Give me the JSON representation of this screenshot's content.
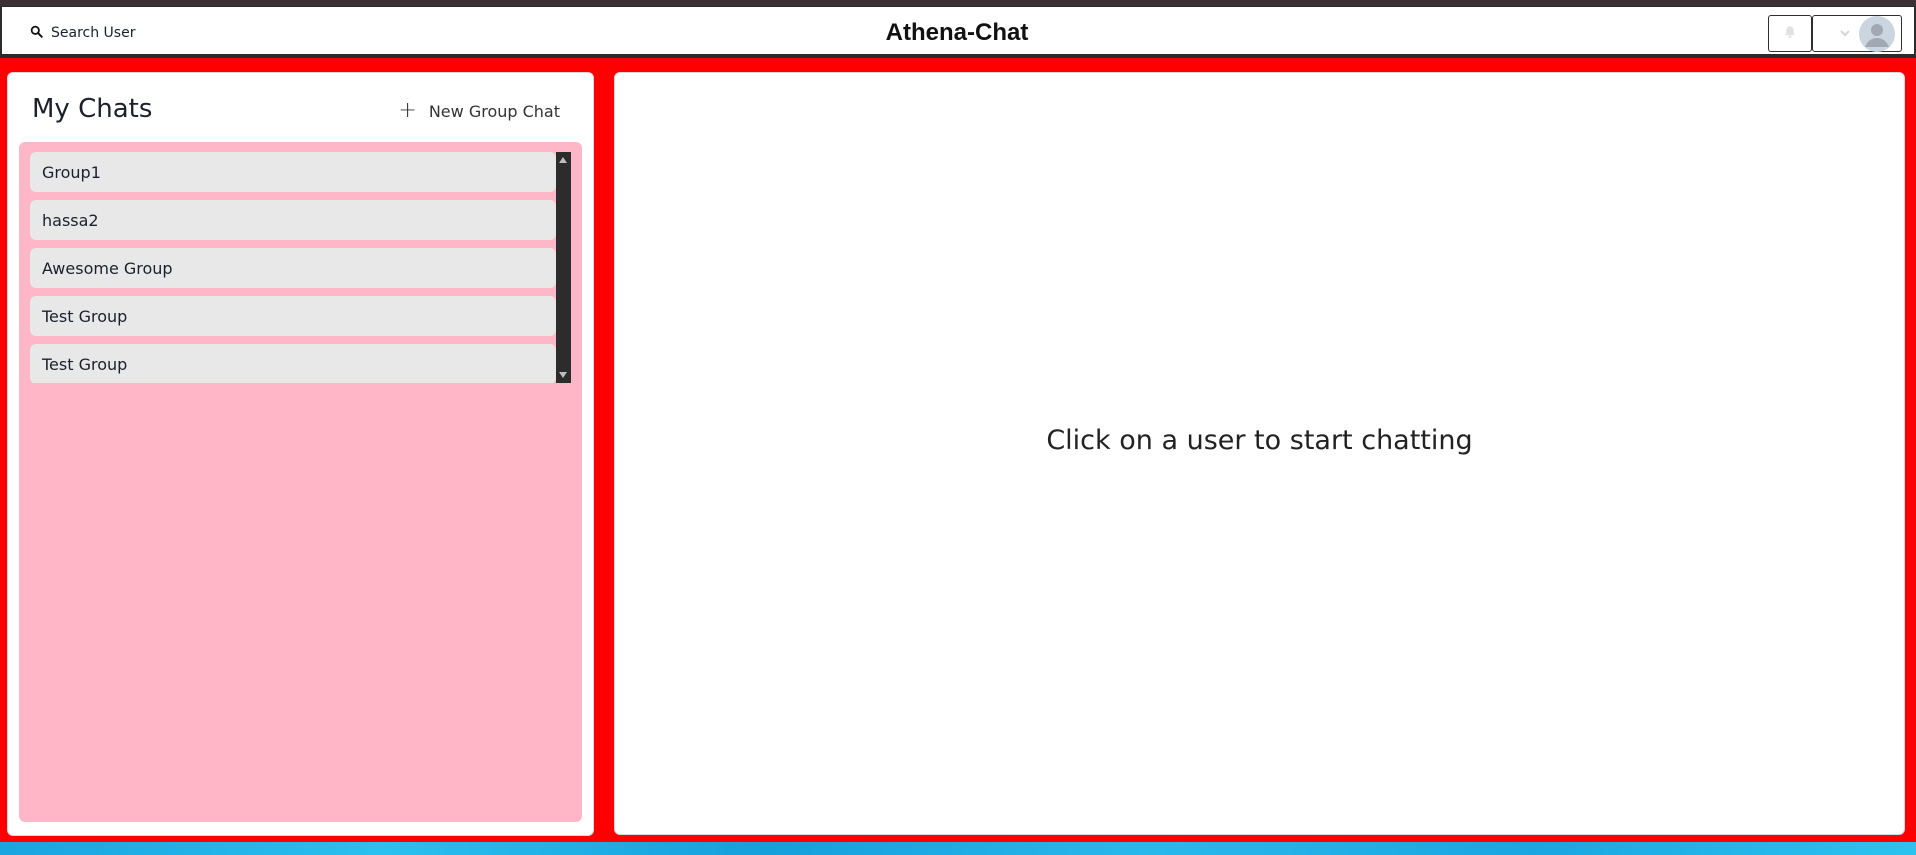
{
  "header": {
    "search_label": "Search User",
    "title": "Athena-Chat",
    "icons": {
      "search": "search-icon",
      "bell": "bell-icon",
      "chevron": "chevron-down-icon",
      "avatar": "user-avatar-icon"
    }
  },
  "sidebar": {
    "title": "My Chats",
    "new_group_label": "New Group Chat",
    "chats": [
      {
        "name": "Group1"
      },
      {
        "name": "hassa2"
      },
      {
        "name": "Awesome Group"
      },
      {
        "name": "Test Group"
      },
      {
        "name": "Test Group"
      }
    ]
  },
  "main": {
    "empty_message": "Click on a user to start chatting"
  },
  "colors": {
    "page_bg": "#ff0000",
    "chat_area_bg": "#ffb6c7",
    "chat_item_bg": "#e8e8e8",
    "footer": "#1aa4e0"
  }
}
